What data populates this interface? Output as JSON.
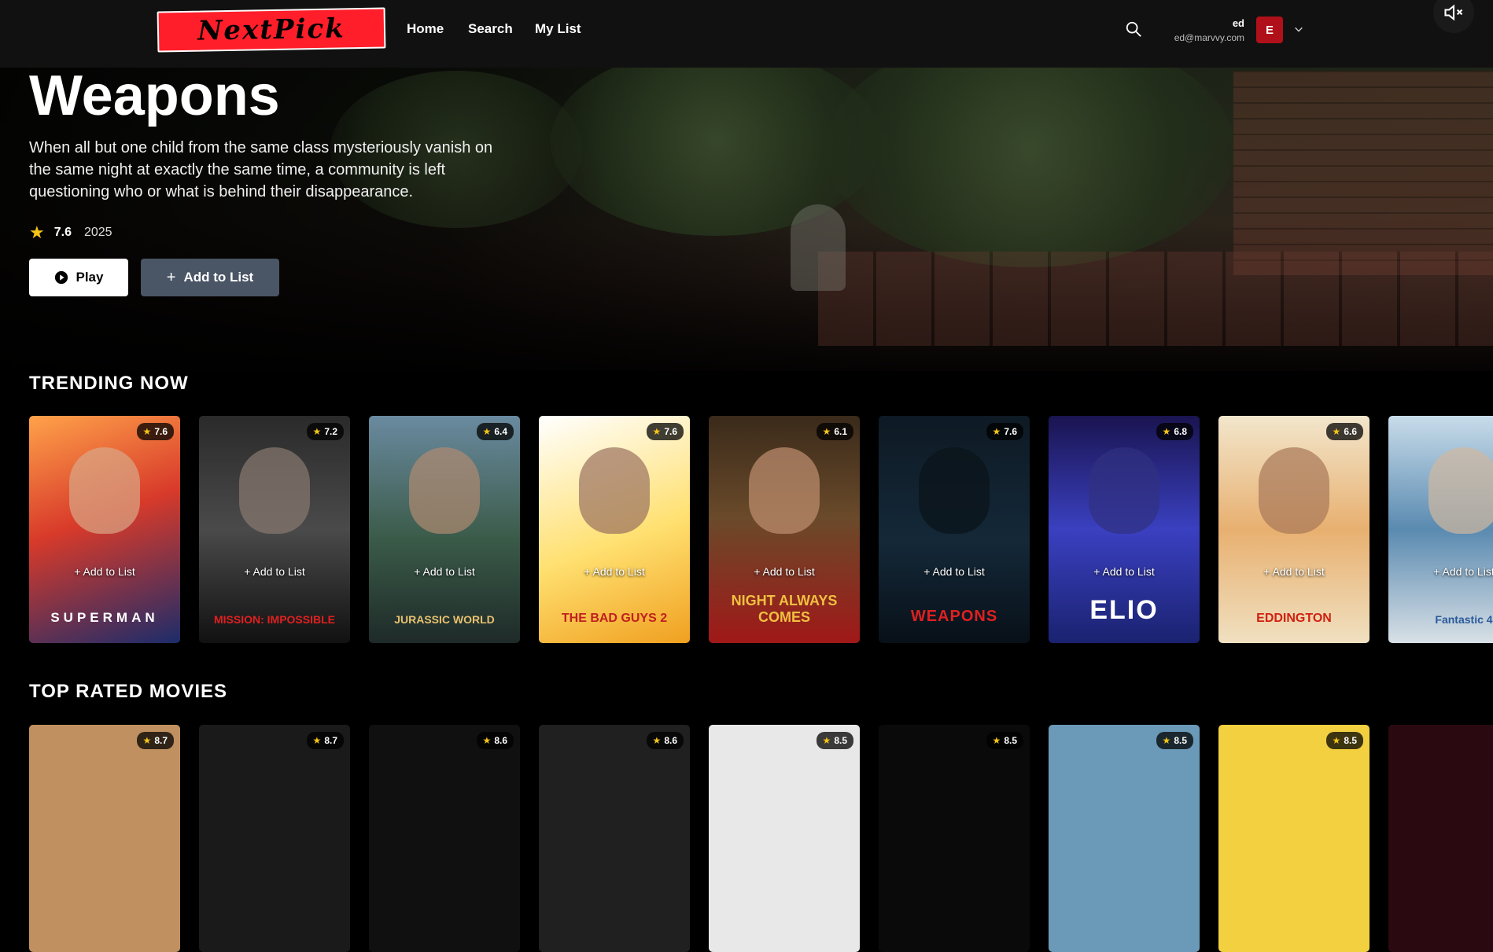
{
  "nav": {
    "logo": "NextPick",
    "links": [
      "Home",
      "Search",
      "My List"
    ],
    "user_name": "ed",
    "user_email": "ed@marvvy.com",
    "avatar_initial": "E"
  },
  "hero": {
    "title": "Weapons",
    "description": "When all but one child from the same class mysteriously vanish on the same night at exactly the same time, a community is left questioning who or what is behind their disappearance.",
    "rating": "7.6",
    "year": "2025",
    "play_label": "Play",
    "add_label": "Add to List"
  },
  "trending": {
    "title": "TRENDING NOW",
    "add_label": "+ Add to List",
    "cards": [
      {
        "title": "SUPERMAN",
        "rating": "7.6"
      },
      {
        "title": "MISSION: IMPOSSIBLE",
        "rating": "7.2"
      },
      {
        "title": "JURASSIC WORLD",
        "rating": "6.4"
      },
      {
        "title": "THE BAD GUYS 2",
        "rating": "7.6"
      },
      {
        "title": "NIGHT ALWAYS COMES",
        "rating": "6.1"
      },
      {
        "title": "WEAPONS",
        "rating": "7.6"
      },
      {
        "title": "ELIO",
        "rating": "6.8"
      },
      {
        "title": "EDDINGTON",
        "rating": "6.6"
      },
      {
        "title": "Fantastic 4",
        "rating": ""
      }
    ]
  },
  "top_rated": {
    "title": "TOP RATED MOVIES",
    "ratings": [
      "8.7",
      "8.7",
      "8.6",
      "8.6",
      "8.5",
      "8.5",
      "8.5",
      "8.5"
    ]
  },
  "colors": {
    "accent": "#b0101a",
    "star": "#f5c518",
    "logo_red": "#ff1e2a"
  }
}
